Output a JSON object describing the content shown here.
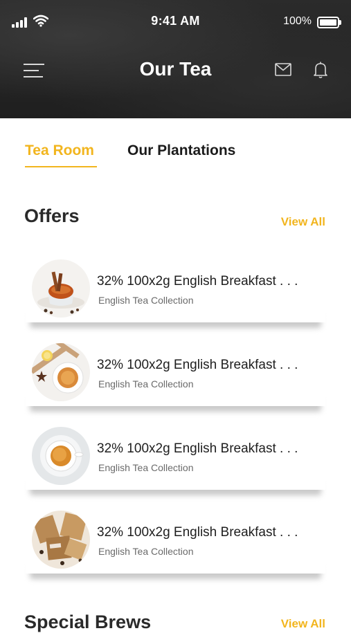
{
  "status_bar": {
    "time": "9:41 AM",
    "battery": "100%"
  },
  "header": {
    "title": "Our Tea"
  },
  "tabs": [
    {
      "label": "Tea Room",
      "active": true
    },
    {
      "label": "Our Plantations",
      "active": false
    }
  ],
  "offers": {
    "heading": "Offers",
    "view_all": "View All",
    "items": [
      {
        "title": "32% 100x2g English Breakfast . . .",
        "subtitle": "English Tea Collection",
        "image": "tea-cup-cinnamon"
      },
      {
        "title": "32% 100x2g English Breakfast . . .",
        "subtitle": "English Tea Collection",
        "image": "tea-lemon-star-anise"
      },
      {
        "title": "32% 100x2g English Breakfast . . .",
        "subtitle": "English Tea Collection",
        "image": "tea-cup-white"
      },
      {
        "title": "32% 100x2g English Breakfast . . .",
        "subtitle": "English Tea Collection",
        "image": "tea-packets"
      }
    ]
  },
  "special_brews": {
    "heading": "Special Brews",
    "view_all": "View All"
  },
  "colors": {
    "accent": "#f2b51e",
    "header_bg": "#242424",
    "text": "#1e1e1e",
    "muted": "#6a6a6a"
  }
}
